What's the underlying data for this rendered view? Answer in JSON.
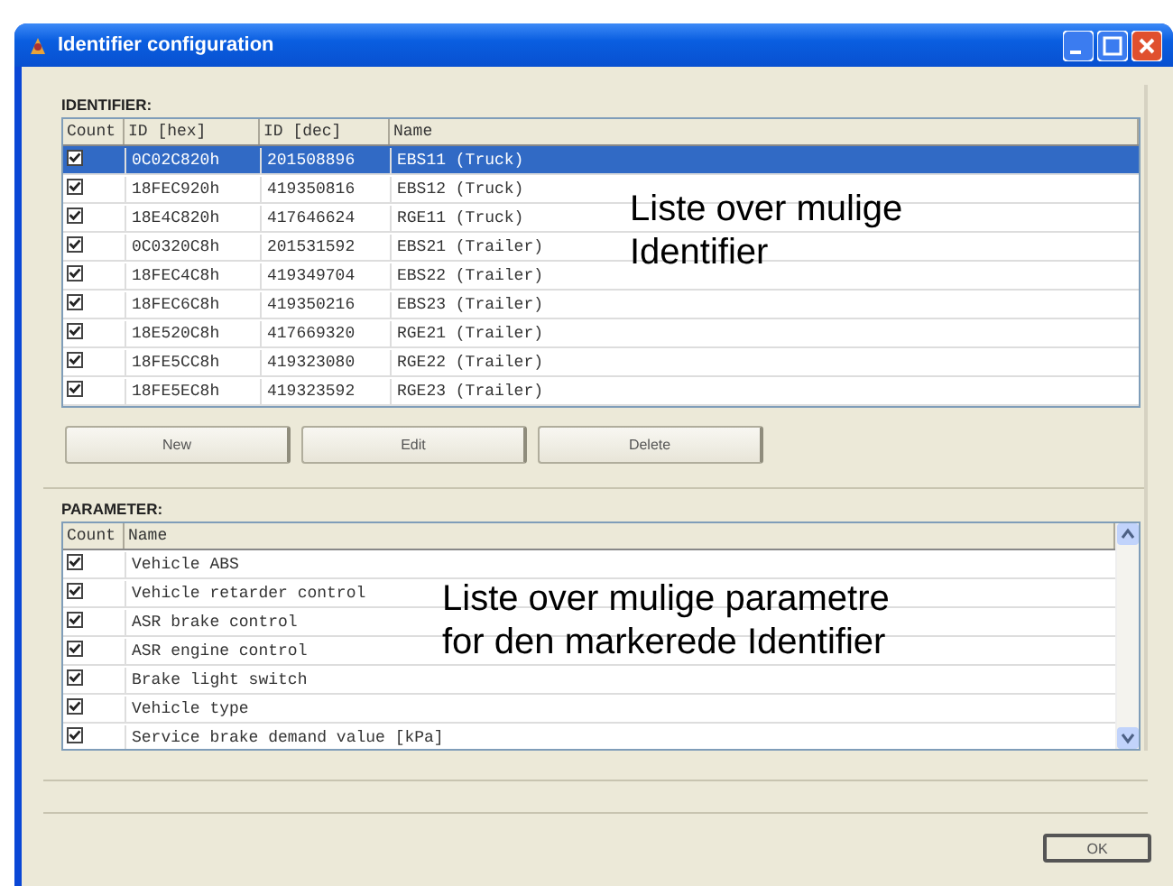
{
  "window": {
    "title": "Identifier configuration"
  },
  "identifier": {
    "label": "IDENTIFIER:",
    "columns": [
      "Count",
      "ID [hex]",
      "ID [dec]",
      "Name"
    ],
    "rows": [
      {
        "checked": true,
        "selected": true,
        "hex": "0C02C820h",
        "dec": "201508896",
        "name": "EBS11 (Truck)"
      },
      {
        "checked": true,
        "selected": false,
        "hex": "18FEC920h",
        "dec": "419350816",
        "name": "EBS12 (Truck)"
      },
      {
        "checked": true,
        "selected": false,
        "hex": "18E4C820h",
        "dec": "417646624",
        "name": "RGE11 (Truck)"
      },
      {
        "checked": true,
        "selected": false,
        "hex": "0C0320C8h",
        "dec": "201531592",
        "name": "EBS21 (Trailer)"
      },
      {
        "checked": true,
        "selected": false,
        "hex": "18FEC4C8h",
        "dec": "419349704",
        "name": "EBS22 (Trailer)"
      },
      {
        "checked": true,
        "selected": false,
        "hex": "18FEC6C8h",
        "dec": "419350216",
        "name": "EBS23 (Trailer)"
      },
      {
        "checked": true,
        "selected": false,
        "hex": "18E520C8h",
        "dec": "417669320",
        "name": "RGE21 (Trailer)"
      },
      {
        "checked": true,
        "selected": false,
        "hex": "18FE5CC8h",
        "dec": "419323080",
        "name": "RGE22 (Trailer)"
      },
      {
        "checked": true,
        "selected": false,
        "hex": "18FE5EC8h",
        "dec": "419323592",
        "name": "RGE23 (Trailer)"
      }
    ],
    "buttons": [
      "New",
      "Edit",
      "Delete"
    ],
    "note": [
      "Liste over mulige",
      "Identifier"
    ]
  },
  "parameter": {
    "label": "PARAMETER:",
    "columns": [
      "Count",
      "Name"
    ],
    "rows": [
      {
        "checked": true,
        "name": "Vehicle ABS"
      },
      {
        "checked": true,
        "name": "Vehicle retarder control"
      },
      {
        "checked": true,
        "name": "ASR brake control"
      },
      {
        "checked": true,
        "name": "ASR engine control"
      },
      {
        "checked": true,
        "name": "Brake light switch"
      },
      {
        "checked": true,
        "name": "Vehicle type"
      },
      {
        "checked": true,
        "name": "Service brake demand value [kPa]"
      }
    ],
    "note": [
      "Liste over mulige parametre",
      "for den markerede Identifier"
    ]
  },
  "ok_button": "OK"
}
